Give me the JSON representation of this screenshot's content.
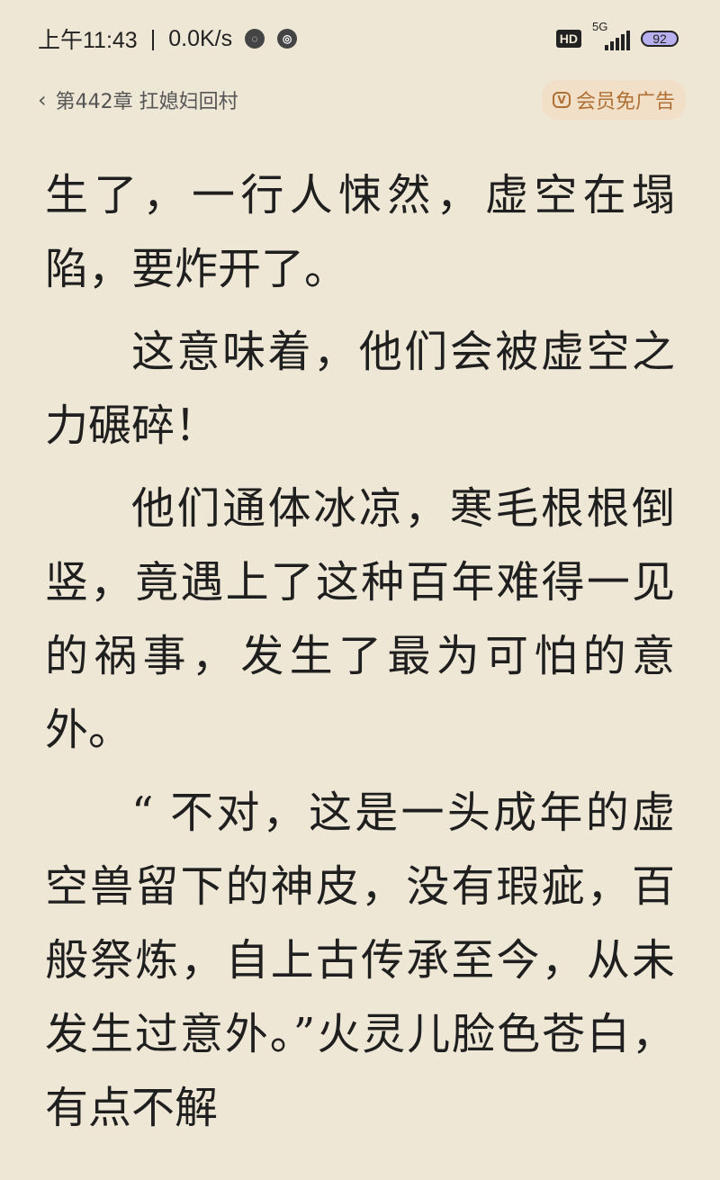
{
  "status": {
    "time": "上午11:43",
    "speed": "0.0K/s",
    "hd": "HD",
    "network": "5G",
    "battery": "92"
  },
  "header": {
    "chapter_title": "第442章 扛媳妇回村",
    "vip_label": "会员免广告"
  },
  "content": {
    "paragraphs": [
      "生了，一行人悚然，虚空在塌陷，要炸开了。",
      "这意味着，他们会被虚空之力碾碎！",
      "他们通体冰凉，寒毛根根倒竖，竟遇上了这种百年难得一见的祸事，发生了最为可怕的意外。",
      "“ 不对，这是一头成年的虚空兽留下的神皮，没有瑕疵，百般祭炼，自上古传承至今，从未发生过意外。”火灵儿脸色苍白，有点不解"
    ]
  }
}
